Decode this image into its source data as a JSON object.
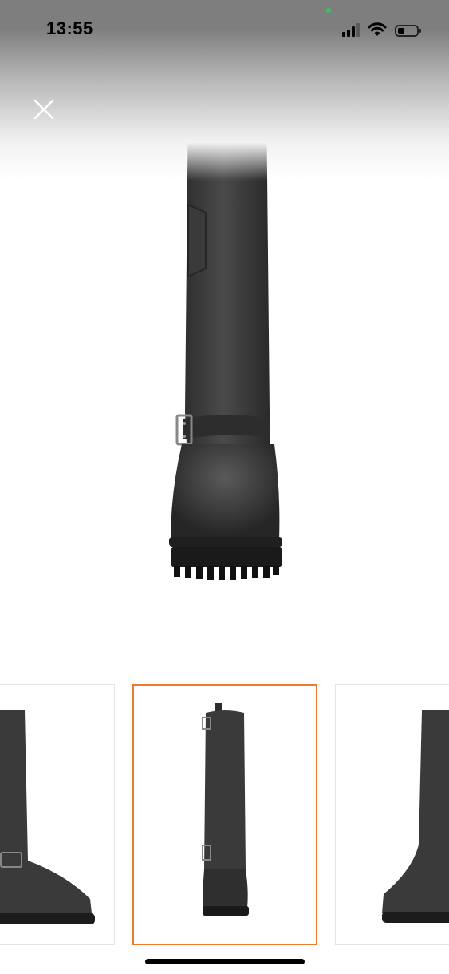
{
  "status_bar": {
    "time": "13:55",
    "background": "#7e7e7e",
    "privacy_dot_color": "#36c45b",
    "icons": [
      "signal-icon",
      "wifi-icon",
      "battery-icon"
    ]
  },
  "viewer": {
    "close_icon": "close-icon",
    "thumbnails": [
      {
        "view": "side",
        "selected": false
      },
      {
        "view": "front",
        "selected": true
      },
      {
        "view": "back-side",
        "selected": false
      }
    ],
    "selected_border_color": "#f07a2c"
  }
}
